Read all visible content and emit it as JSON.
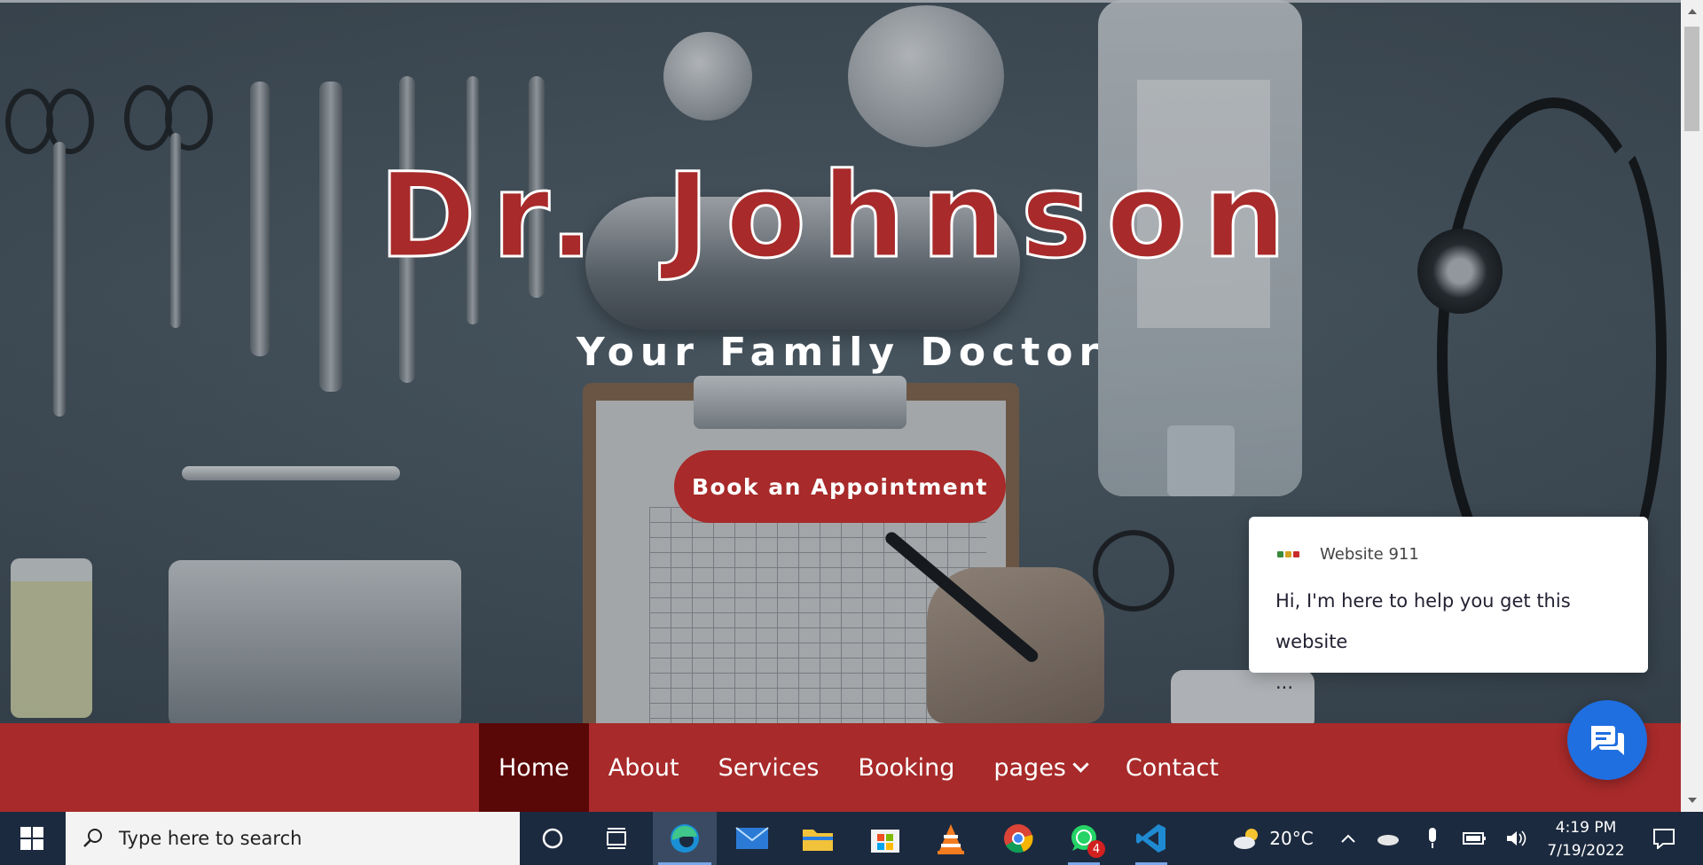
{
  "hero": {
    "title": "Dr. Johnson",
    "subtitle": "Your Family Doctor",
    "cta_label": "Book an Appointment"
  },
  "nav": {
    "items": [
      {
        "label": "Home",
        "active": true
      },
      {
        "label": "About"
      },
      {
        "label": "Services"
      },
      {
        "label": "Booking"
      },
      {
        "label": "pages",
        "dropdown": true
      },
      {
        "label": "Contact"
      }
    ]
  },
  "chat": {
    "agent_name": "Website 911",
    "message_line1": "Hi, I'm here to help you get this website",
    "message_line2": "...",
    "launcher_icon": "chat-bubbles-icon"
  },
  "taskbar": {
    "search_placeholder": "Type here to search",
    "weather": "20°C",
    "time": "4:19 PM",
    "date": "7/19/2022",
    "whatsapp_badge": "4",
    "apps": [
      "cortana-icon",
      "task-view-icon",
      "edge-icon",
      "mail-icon",
      "file-explorer-icon",
      "store-icon",
      "vlc-icon",
      "chrome-icon",
      "whatsapp-icon",
      "vscode-icon"
    ]
  },
  "colors": {
    "brand": "#a82a2a",
    "nav_active": "#5a0707",
    "chat_launcher": "#1f6fe0",
    "taskbar": "#1c2a3f"
  }
}
